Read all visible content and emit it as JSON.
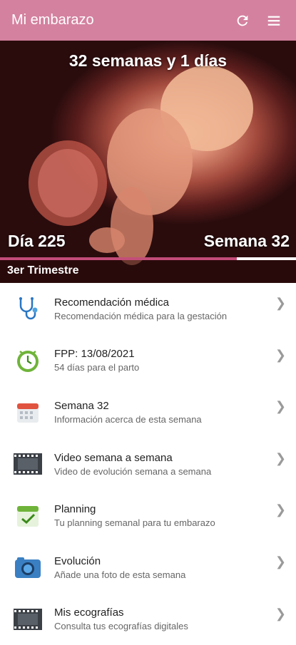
{
  "appbar": {
    "title": "Mi embarazo"
  },
  "hero": {
    "weeks": "32 semanas y 1 días",
    "day": "Día 225",
    "week": "Semana 32",
    "trimester": "3er Trimestre",
    "progress": 0.8
  },
  "items": [
    {
      "icon": "stethoscope-icon",
      "title": "Recomendación médica",
      "subtitle": "Recomendación médica para la gestación"
    },
    {
      "icon": "clock-icon",
      "title": "FPP: 13/08/2021",
      "subtitle": "54 días para el parto"
    },
    {
      "icon": "calendar-icon",
      "title": "Semana 32",
      "subtitle": "Información acerca de esta semana"
    },
    {
      "icon": "film-icon",
      "title": "Video semana a semana",
      "subtitle": "Video de evolución semana a semana"
    },
    {
      "icon": "calendar-check-icon",
      "title": "Planning",
      "subtitle": "Tu planning semanal para tu embarazo"
    },
    {
      "icon": "camera-icon",
      "title": "Evolución",
      "subtitle": "Añade una foto de esta semana"
    },
    {
      "icon": "film-icon",
      "title": "Mis ecografías",
      "subtitle": "Consulta tus ecografías digitales"
    }
  ],
  "colors": {
    "appbar": "#d4819f",
    "progress": "#c24d79"
  }
}
